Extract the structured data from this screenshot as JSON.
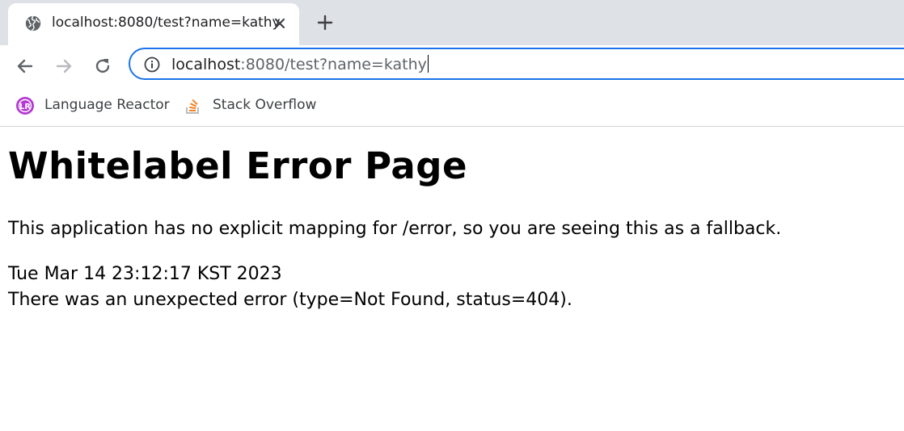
{
  "browser": {
    "tab": {
      "title": "localhost:8080/test?name=kathy",
      "favicon": "globe-icon"
    },
    "address_bar": {
      "host": "localhost",
      "path": ":8080/test?name=kathy",
      "accent_color": "#1a73e8"
    },
    "bookmarks": [
      {
        "label": "Language Reactor",
        "icon": "language-reactor-icon"
      },
      {
        "label": "Stack Overflow",
        "icon": "stack-overflow-icon"
      }
    ]
  },
  "page": {
    "heading": "Whitelabel Error Page",
    "message": "This application has no explicit mapping for /error, so you are seeing this as a fallback.",
    "timestamp": "Tue Mar 14 23:12:17 KST 2023",
    "error": "There was an unexpected error (type=Not Found, status=404)."
  }
}
